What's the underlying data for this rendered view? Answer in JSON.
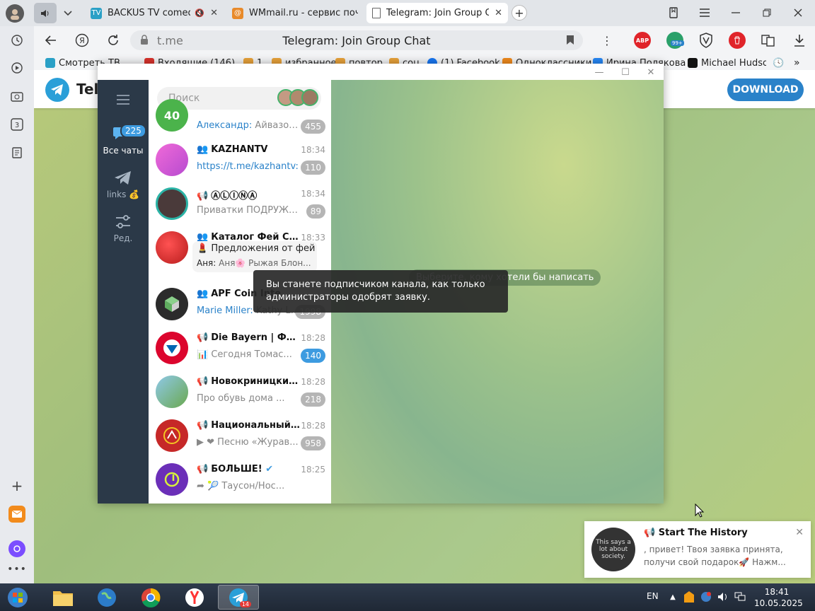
{
  "browser": {
    "tabs": [
      {
        "title": "BACKUS TV comedy",
        "muted": true
      },
      {
        "title": "WMmail.ru - сервис почто"
      },
      {
        "title": "Telegram: Join Group C",
        "active": true
      }
    ],
    "address": {
      "host": "t.me",
      "page_title": "Telegram: Join Group Chat"
    },
    "extension_badge": "99+",
    "bookmarks": [
      {
        "label": "Смотреть ТВ",
        "color": "#2aa0c6"
      },
      {
        "label": "Входящие (146)",
        "color": "#d9322c"
      },
      {
        "label": "1",
        "color": "#e8a23a"
      },
      {
        "label": "избранное",
        "color": "#e8a23a"
      },
      {
        "label": "повтор",
        "color": "#e8a23a"
      },
      {
        "label": "соц",
        "color": "#e8a23a"
      },
      {
        "label": "(1) Facebook",
        "color": "#1877f2"
      },
      {
        "label": "Одноклассники",
        "color": "#f08a1c"
      },
      {
        "label": "Ирина Полякова",
        "color": "#2787f5"
      },
      {
        "label": "Michael Hudso",
        "color": "#111111"
      }
    ]
  },
  "page": {
    "brand": "Telegram",
    "download_label": "DOWNLOAD"
  },
  "telegram": {
    "folders": [
      {
        "label": "Все чаты",
        "badge": "225",
        "active": true
      },
      {
        "label": "links 💰"
      },
      {
        "label": "Ред."
      }
    ],
    "search_placeholder": "Поиск",
    "chats": [
      {
        "name": "",
        "time": "",
        "sender": "Александр:",
        "preview": " Айвазовск...",
        "badge": "455",
        "avatar_text": "40",
        "avatar_color": "#4bb34b"
      },
      {
        "name": "KAZHANTV",
        "kind": "group",
        "time": "18:34",
        "sender": "",
        "preview": "https://t.me/kazhantv:",
        "preview_link": true,
        "badge": "110",
        "avatar_text": "",
        "avatar_color": "#e86ad0"
      },
      {
        "name": "ⒶⓁⒾⓃⒶ",
        "kind": "channel",
        "time": "18:34",
        "sender": "",
        "preview": "Приватки ПОДРУЖЕК ...",
        "badge": "89",
        "avatar_text": "",
        "avatar_color": "#4a3a3a"
      },
      {
        "name": "Каталог Фей СПб",
        "kind": "group",
        "time": "18:33",
        "sender": "",
        "preview": "",
        "badge": "",
        "avatar_text": "",
        "avatar_color": "#d32f2f"
      },
      {
        "name": "APF Coin Inte",
        "kind": "group",
        "time": "",
        "sender": "Marie Miller:",
        "preview": " Kathy Li...",
        "badge": "1998",
        "avatar_text": "",
        "avatar_color": "#2b2b2b"
      },
      {
        "name": "Die Bayern | ФК Б...",
        "kind": "channel",
        "time": "18:28",
        "sender": "",
        "preview": "📊 Сегодня Томас...",
        "badge": "140",
        "badge_blue": true,
        "avatar_text": "",
        "avatar_color": "#dc052d"
      },
      {
        "name": "Новокриницкие ...",
        "kind": "channel",
        "time": "18:28",
        "sender": "",
        "preview": "Про обувь дома ...",
        "badge": "218",
        "avatar_text": "",
        "avatar_color": "#6aa84f"
      },
      {
        "name": "Национальный ц...",
        "kind": "channel",
        "time": "18:28",
        "sender": "",
        "preview": "❤ Песню «Журав...",
        "badge": "958",
        "avatar_text": "",
        "avatar_color": "#c62828"
      },
      {
        "name": "БОЛЬШЕ!",
        "kind": "channel",
        "verified": true,
        "time": "18:25",
        "sender": "",
        "preview": "🎾 Таусон/Нос...",
        "badge": "",
        "avatar_text": "",
        "avatar_color": "#6b2fb8"
      }
    ],
    "popup": {
      "line1": "Предложения от фей",
      "line2_sender": "Аня:",
      "line2": " Аня🌸  Рыжая Блон..."
    },
    "empty_hint": "Выберите, кому хотели бы написать"
  },
  "tooltip": {
    "text": "Вы станете подписчиком канала, как только администраторы одобрят заявку."
  },
  "notification": {
    "title": "📢 Start The History",
    "body": ", привет! Твоя заявка принята, получи свой подарок🚀  Нажм...",
    "avatar_caption": "This says a lot about society."
  },
  "taskbar": {
    "telegram_badge": "14",
    "language": "EN",
    "time": "18:41",
    "date": "10.05.2025"
  }
}
